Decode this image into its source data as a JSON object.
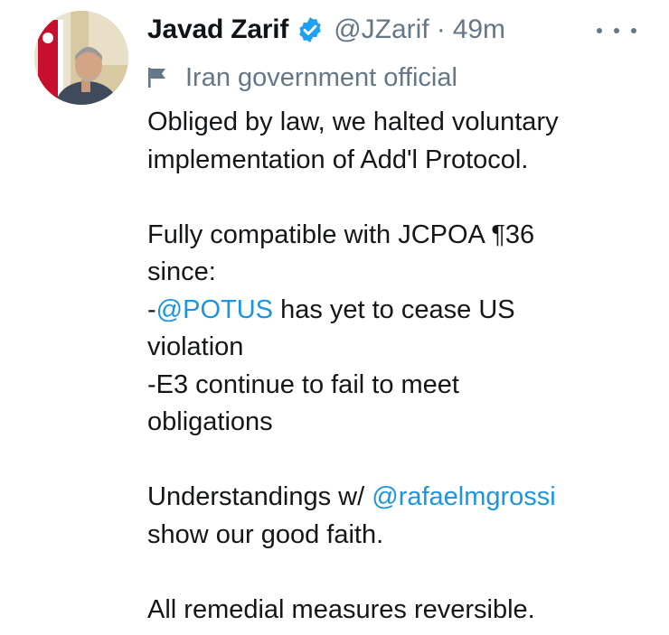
{
  "author": {
    "display_name": "Javad Zarif",
    "handle": "@JZarif",
    "separator": "·",
    "timestamp": "49m",
    "label": "Iran government official",
    "verified": true
  },
  "tweet": {
    "p1": {
      "l1": "Obliged by law, we halted voluntary",
      "l2": "implementation of Add'l Protocol."
    },
    "p2": {
      "l1": "Fully compatible with JCPOA ¶36",
      "l2": "since:",
      "l3_prefix": "-",
      "l3_mention": "@POTUS",
      "l3_suffix": " has yet to cease US",
      "l4": "violation",
      "l5": "-E3 continue to fail to meet",
      "l6": "obligations"
    },
    "p3": {
      "l1_prefix": "Understandings w/ ",
      "l1_mention": "@rafaelmgrossi",
      "l2": "show our good faith."
    },
    "p4": {
      "l1": "All remedial measures reversible."
    }
  },
  "colors": {
    "mention": "#1b95e0",
    "secondary_text": "#657786",
    "verified_badge": "#1da1f2"
  },
  "icons": {
    "verified": "verified-badge-icon",
    "label": "flag-icon",
    "more": "more-options-icon"
  }
}
